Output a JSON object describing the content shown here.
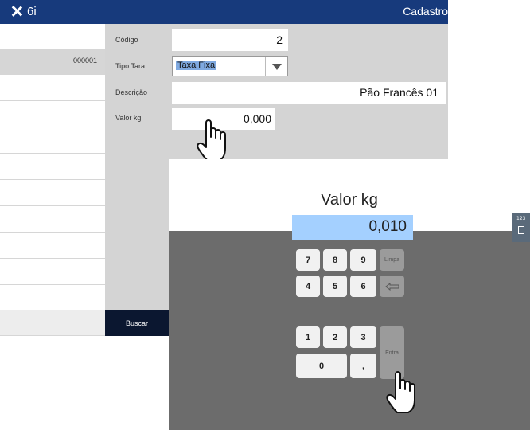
{
  "titlebar": {
    "id": "6i",
    "title": "Cadastro"
  },
  "list": {
    "rows": [
      "",
      "000001",
      "",
      "",
      "",
      "",
      "",
      "",
      "",
      "",
      ""
    ],
    "search_label": "Buscar"
  },
  "form": {
    "codigo_label": "Código",
    "codigo_value": "2",
    "tipo_tara_label": "Tipo Tara",
    "tipo_tara_value": "Taxa Fixa",
    "descricao_label": "Descrição",
    "descricao_value": "Pão Francês 01",
    "valor_kg_label": "Valor kg",
    "valor_kg_value": "0,000"
  },
  "keypad": {
    "title": "Valor kg",
    "display": "0,010",
    "keys": [
      "7",
      "8",
      "9",
      "4",
      "5",
      "6",
      "1",
      "2",
      "3",
      "0",
      ","
    ],
    "clear_label": "Limpa",
    "enter_label": "Entra",
    "side_tab_label": "123"
  },
  "colors": {
    "titlebar": "#173a7c",
    "display": "#a4d0ff",
    "keypad_bg": "#6c6c6c",
    "form_bg": "#d4d4d4"
  },
  "icons": [
    "close-icon",
    "dropdown-arrow-icon",
    "backspace-icon",
    "hand-cursor-icon",
    "keyboard-icon"
  ]
}
